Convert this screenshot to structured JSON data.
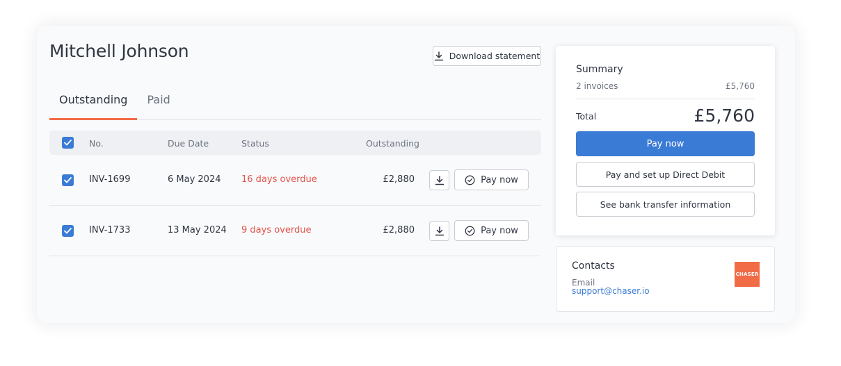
{
  "customer": {
    "name": "Mitchell Johnson"
  },
  "actions": {
    "download_statement": "Download statement"
  },
  "tabs": [
    {
      "label": "Outstanding",
      "active": true
    },
    {
      "label": "Paid",
      "active": false
    }
  ],
  "table": {
    "headers": {
      "no": "No.",
      "due_date": "Due Date",
      "status": "Status",
      "outstanding": "Outstanding"
    },
    "all_selected": true,
    "rows": [
      {
        "no": "INV-1699",
        "due_date": "6 May 2024",
        "status": "16 days overdue",
        "outstanding": "£2,880",
        "selected": true,
        "pay_label": "Pay now"
      },
      {
        "no": "INV-1733",
        "due_date": "13 May 2024",
        "status": "9 days overdue",
        "outstanding": "£2,880",
        "selected": true,
        "pay_label": "Pay now"
      }
    ]
  },
  "summary": {
    "title": "Summary",
    "count": "2 invoices",
    "amount": "£5,760",
    "total_label": "Total",
    "total_value": "£5,760",
    "pay_now": "Pay now",
    "direct_debit": "Pay and set up Direct Debit",
    "bank_transfer": "See bank transfer information"
  },
  "contacts": {
    "title": "Contacts",
    "email_label": "Email",
    "email": "support@chaser.io",
    "logo_text": "CHASER"
  },
  "colors": {
    "accent": "#3a7bd5",
    "brand": "#f26b47",
    "overdue": "#e5534b"
  },
  "icons": {
    "download": "download-icon",
    "pay": "check-circle-icon",
    "checkbox": "check-icon"
  }
}
